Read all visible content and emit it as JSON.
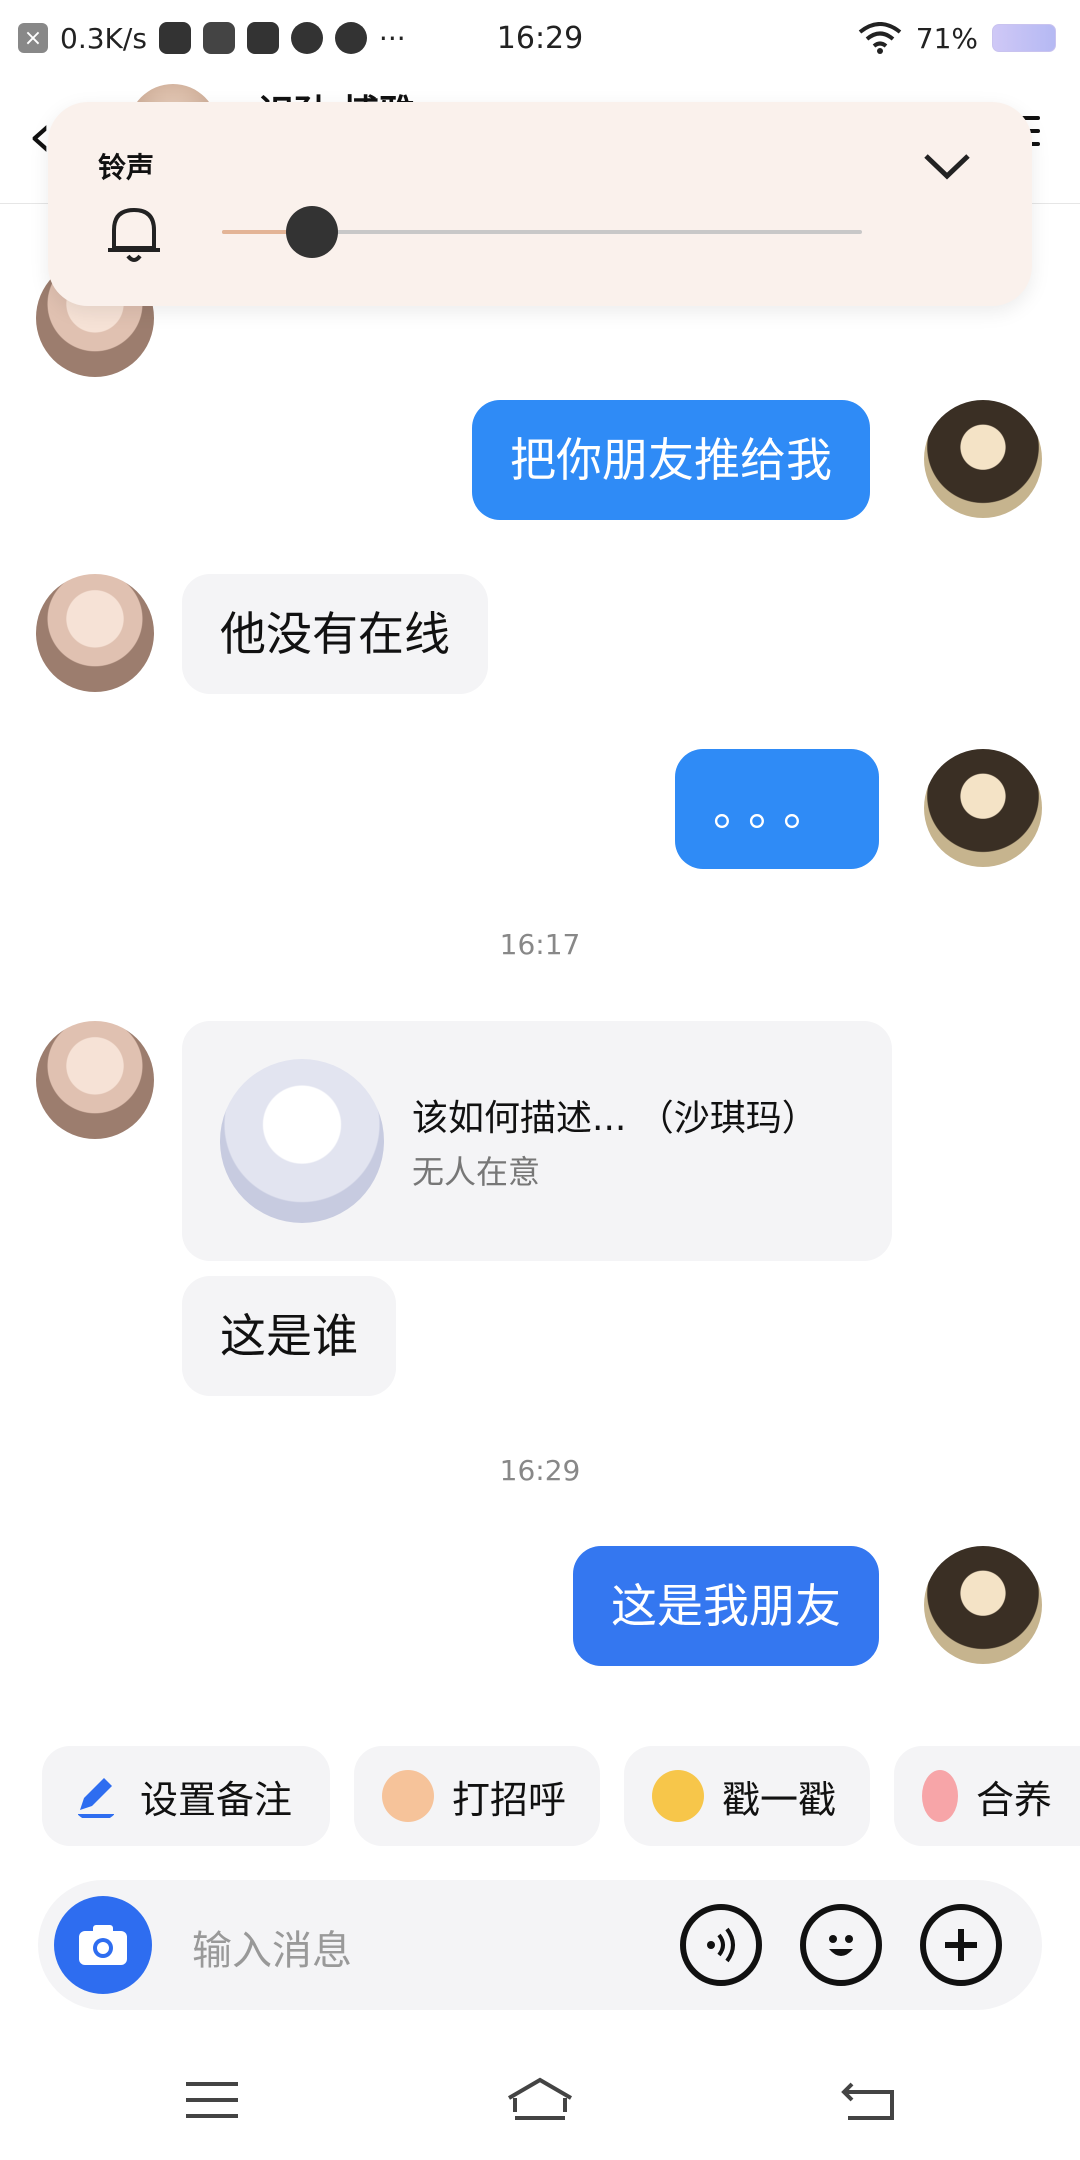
{
  "status_bar": {
    "speed": "0.3K/s",
    "time": "16:29",
    "battery": "71%"
  },
  "header": {
    "contact_name": "识孙 博雅g"
  },
  "volume_panel": {
    "label": "铃声",
    "level": 0.14
  },
  "messages": [
    {
      "side": "in",
      "text": ""
    },
    {
      "side": "out",
      "text": "把你朋友推给我"
    },
    {
      "side": "in",
      "text": "他没有在线"
    },
    {
      "side": "out",
      "text": "。。。"
    },
    {
      "timestamp": "16:17"
    },
    {
      "side": "in",
      "card": {
        "title": "该如何描述... （沙琪玛）",
        "subtitle": "无人在意"
      }
    },
    {
      "side": "in",
      "text": "这是谁"
    },
    {
      "timestamp": "16:29"
    },
    {
      "side": "out",
      "text": "这是我朋友"
    }
  ],
  "quick_actions": [
    {
      "label": "设置备注",
      "icon": "edit-icon"
    },
    {
      "label": "打招呼",
      "icon": "wave-hand-icon"
    },
    {
      "label": "戳一戳",
      "icon": "poke-emoji-icon"
    },
    {
      "label": "合养",
      "icon": "pet-icon"
    }
  ],
  "input": {
    "placeholder": "输入消息"
  },
  "colors": {
    "bubble_out": "#2f8bf6",
    "bubble_in": "#f4f4f6",
    "accent": "#2e6df0",
    "volume_panel_bg": "#faf1ec"
  }
}
